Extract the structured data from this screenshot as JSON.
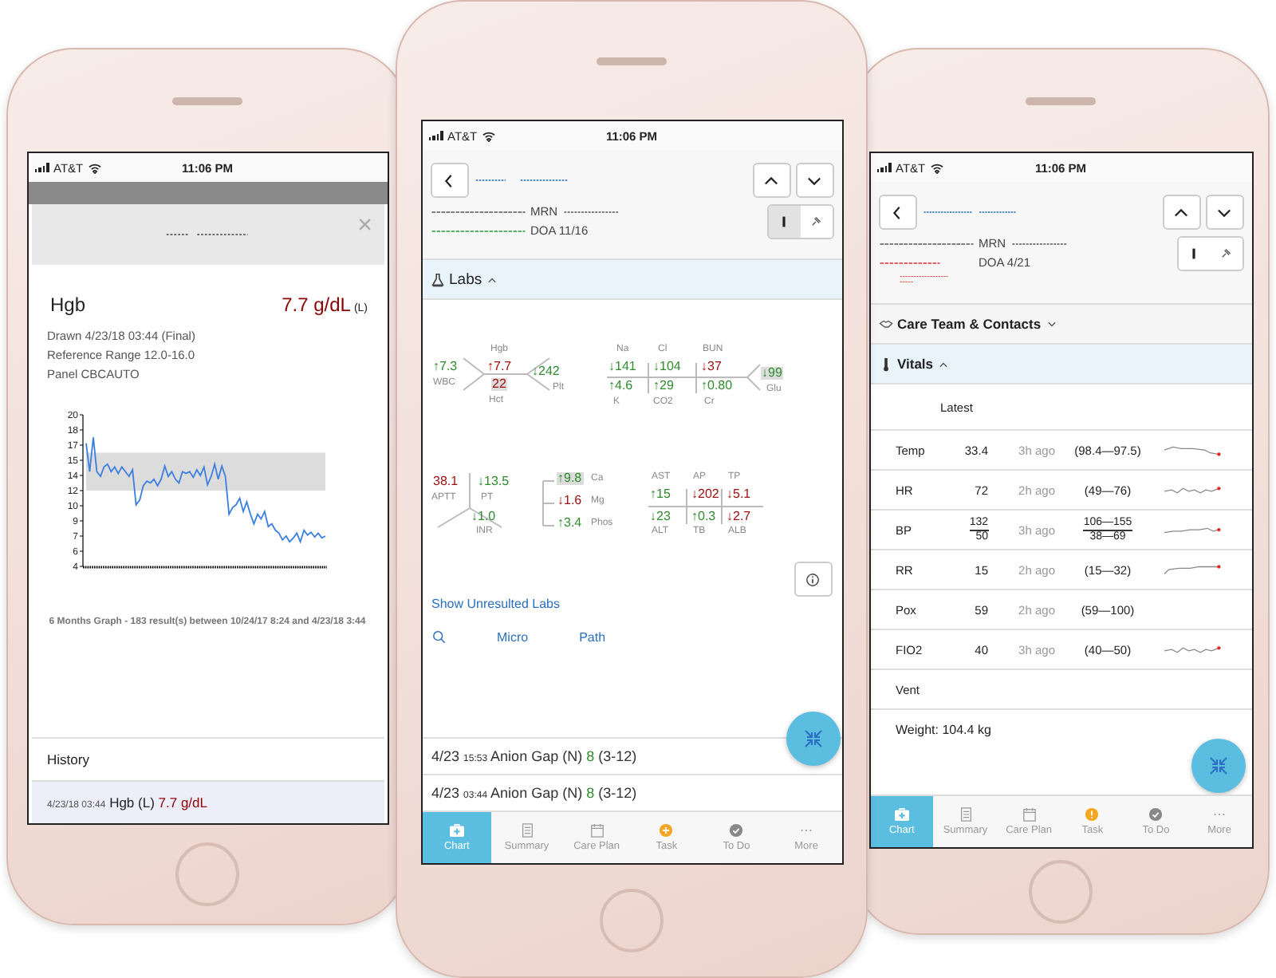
{
  "left_phone": {
    "status_bar": {
      "carrier": "AT&T",
      "time": "11:06 PM"
    },
    "modal": {
      "close": "×",
      "title": "Hgb",
      "value": "7.7 g/dL",
      "flag": "(L)",
      "details": [
        "Drawn 4/23/18 03:44 (Final)",
        "Reference Range 12.0-16.0",
        "Panel CBCAUTO"
      ],
      "chart_data": {
        "type": "line",
        "ylim": [
          4,
          20
        ],
        "yticks": [
          {
            "value": 4,
            "label": "4"
          },
          {
            "value": 5.6,
            "label": "6"
          },
          {
            "value": 7.2,
            "label": "7"
          },
          {
            "value": 8.8,
            "label": "9"
          },
          {
            "value": 10.4,
            "label": "10"
          },
          {
            "value": 12,
            "label": "12"
          },
          {
            "value": 13.6,
            "label": "14"
          },
          {
            "value": 15.2,
            "label": "15"
          },
          {
            "value": 16.8,
            "label": "17"
          },
          {
            "value": 18.4,
            "label": "18"
          },
          {
            "value": 20,
            "label": "20"
          }
        ],
        "values": [
          17,
          14,
          17.6,
          14,
          13.5,
          14.5,
          14.8,
          14,
          14.5,
          13.8,
          14.5,
          14,
          13.5,
          14.2,
          10.5,
          11,
          12.5,
          13,
          12.8,
          13.2,
          12.5,
          13.2,
          14.6,
          13.5,
          14,
          13.2,
          12.8,
          14,
          13.8,
          14,
          13.4,
          14.2,
          13.6,
          14.5,
          12.6,
          13.5,
          14.8,
          13.2,
          14.6,
          13.5,
          9.5,
          10.2,
          10.5,
          11.2,
          9.8,
          10.8,
          9.5,
          8.5,
          9.5,
          9,
          9.8,
          8.2,
          8.5,
          7.8,
          7.5,
          6.8,
          7.2,
          6.6,
          7,
          7.5,
          6.6,
          7.8,
          7.3,
          7.6,
          7.1,
          7.5,
          7,
          7.2
        ],
        "bands": [
          {
            "axis": "y",
            "from": 12,
            "to": 16
          }
        ]
      },
      "caption": "6 Months Graph - 183 result(s) between 10/24/17 8:24 and 4/23/18 3:44"
    },
    "history": {
      "title": "History",
      "rows": [
        {
          "date": "4/23/18 03:44",
          "test": "Hgb (L)",
          "value": "7.7 g/dL",
          "selected": true
        }
      ]
    }
  },
  "center_phone": {
    "status_bar": {
      "carrier": "AT&T",
      "time": "11:06 PM"
    },
    "header": {
      "mrn_label": "MRN",
      "doa": "DOA 11/16",
      "view_toggle": [
        {
          "selected": true
        },
        {
          "selected": false
        }
      ]
    },
    "sections": [
      {
        "title": "Labs",
        "expanded": true
      }
    ],
    "lab_panels": [
      {
        "kind": "cbc",
        "items": [
          {
            "label": "WBC",
            "value": "↑7.3",
            "abnormal": false,
            "highlighted": false
          },
          {
            "label": "Hgb",
            "value": "↑7.7",
            "abnormal": true,
            "highlighted": false
          },
          {
            "label": "Hct",
            "value": "22",
            "abnormal": true,
            "highlighted": true
          },
          {
            "label": "Plt",
            "value": "↓242",
            "abnormal": false,
            "highlighted": false
          }
        ]
      },
      {
        "kind": "bmp",
        "items": [
          {
            "label": "Na",
            "value": "↓141",
            "abnormal": false,
            "highlighted": false
          },
          {
            "label": "Cl",
            "value": "↓104",
            "abnormal": false,
            "highlighted": false
          },
          {
            "label": "BUN",
            "value": "↓37",
            "abnormal": true,
            "highlighted": false
          },
          {
            "label": "K",
            "value": "↑4.6",
            "abnormal": false,
            "highlighted": false
          },
          {
            "label": "CO2",
            "value": "↑29",
            "abnormal": false,
            "highlighted": false
          },
          {
            "label": "Cr",
            "value": "↑0.80",
            "abnormal": false,
            "highlighted": false
          },
          {
            "label": "Glu",
            "value": "↓99",
            "abnormal": false,
            "highlighted": true
          }
        ]
      },
      {
        "kind": "coag",
        "items": [
          {
            "label": "APTT",
            "value": "38.1",
            "abnormal": true,
            "highlighted": false
          },
          {
            "label": "PT",
            "value": "↓13.5",
            "abnormal": false,
            "highlighted": false
          },
          {
            "label": "INR",
            "value": "↓1.0",
            "abnormal": false,
            "highlighted": false
          }
        ]
      },
      {
        "kind": "minerals",
        "items": [
          {
            "label": "Ca",
            "value": "↑9.8",
            "abnormal": false,
            "highlighted": true
          },
          {
            "label": "Mg",
            "value": "↓1.6",
            "abnormal": true,
            "highlighted": false
          },
          {
            "label": "Phos",
            "value": "↑3.4",
            "abnormal": false,
            "highlighted": false
          }
        ]
      },
      {
        "kind": "lft",
        "items": [
          {
            "label": "AST",
            "value": "↑15",
            "abnormal": false,
            "highlighted": false
          },
          {
            "label": "AP",
            "value": "↓202",
            "abnormal": true,
            "highlighted": false
          },
          {
            "label": "TP",
            "value": "↓5.1",
            "abnormal": true,
            "highlighted": false
          },
          {
            "label": "ALT",
            "value": "↓23",
            "abnormal": false,
            "highlighted": false
          },
          {
            "label": "TB",
            "value": "↑0.3",
            "abnormal": false,
            "highlighted": false
          },
          {
            "label": "ALB",
            "value": "↓2.7",
            "abnormal": true,
            "highlighted": false
          }
        ]
      }
    ],
    "links": {
      "unresulted": "Show Unresulted Labs",
      "others": [
        "Micro",
        "Path"
      ]
    },
    "results": [
      {
        "date": "4/23",
        "time": "15:53",
        "test": "Anion Gap (N)",
        "value": "8",
        "range": "(3-12)"
      },
      {
        "date": "4/23",
        "time": "03:44",
        "test": "Anion Gap (N)",
        "value": "8",
        "range": "(3-12)"
      }
    ],
    "tabs": [
      {
        "label": "Chart",
        "selected": true
      },
      {
        "label": "Summary",
        "selected": false
      },
      {
        "label": "Care Plan",
        "selected": false
      },
      {
        "label": "Task",
        "selected": false
      },
      {
        "label": "To Do",
        "selected": false
      },
      {
        "label": "More",
        "selected": false
      }
    ]
  },
  "right_phone": {
    "status_bar": {
      "carrier": "AT&T",
      "time": "11:06 PM"
    },
    "header": {
      "mrn_label": "MRN",
      "doa": "DOA 4/21",
      "view_toggle": [
        {
          "selected": false
        },
        {
          "selected": false
        }
      ]
    },
    "sections": [
      {
        "title": "Care Team & Contacts",
        "expanded": false
      },
      {
        "title": "Vitals",
        "expanded": true
      }
    ],
    "vitals": {
      "column": "Latest",
      "rows": [
        {
          "kind": "single",
          "name": "Temp",
          "value": "33.4",
          "time": "3h ago",
          "range": "(98.4—97.5)",
          "trend": true
        },
        {
          "kind": "single",
          "name": "HR",
          "value": "72",
          "time": "2h ago",
          "range": "(49—76)",
          "trend": true
        },
        {
          "kind": "fraction",
          "name": "BP",
          "value": "132",
          "value_low": "50",
          "time": "3h ago",
          "range": "106—155",
          "range_low": "38—69",
          "trend": true
        },
        {
          "kind": "single",
          "name": "RR",
          "value": "15",
          "time": "2h ago",
          "range": "(15—32)",
          "trend": true
        },
        {
          "kind": "single",
          "name": "Pox",
          "value": "59",
          "time": "2h ago",
          "range": "(59—100)",
          "trend": false
        },
        {
          "kind": "single",
          "name": "FIO2",
          "value": "40",
          "time": "3h ago",
          "range": "(40—50)",
          "trend": true
        },
        {
          "kind": "label",
          "name": "Vent"
        }
      ]
    },
    "weight": "Weight: 104.4 kg",
    "tabs": [
      {
        "label": "Chart",
        "selected": true
      },
      {
        "label": "Summary",
        "selected": false
      },
      {
        "label": "Care Plan",
        "selected": false
      },
      {
        "label": "Task",
        "selected": false
      },
      {
        "label": "To Do",
        "selected": false
      },
      {
        "label": "More",
        "selected": false
      }
    ]
  }
}
